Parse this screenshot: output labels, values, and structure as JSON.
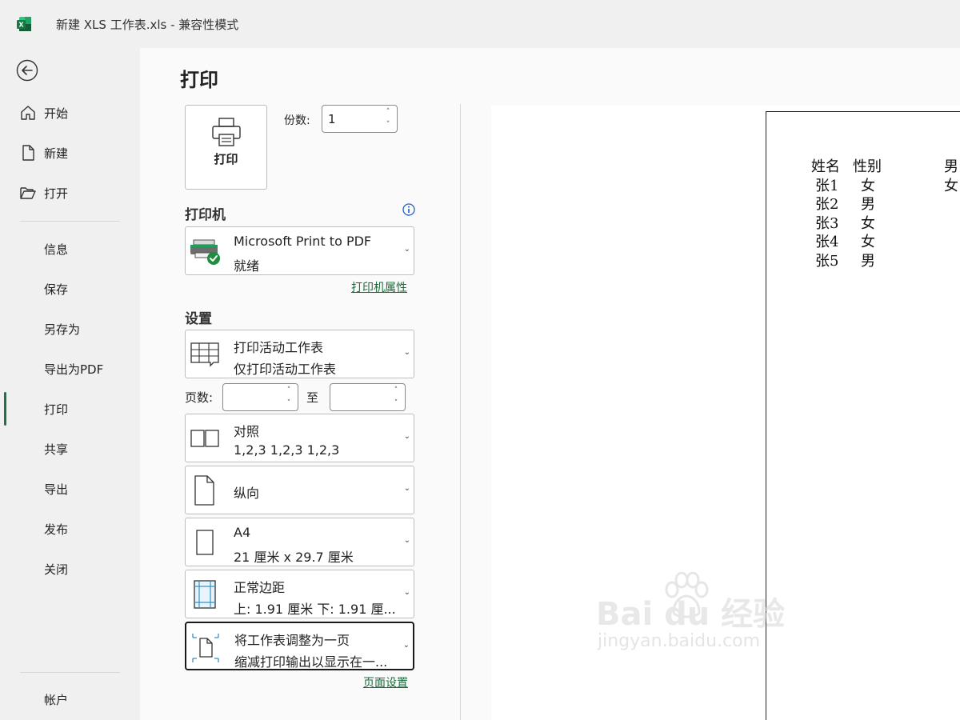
{
  "window": {
    "title": "新建 XLS 工作表.xls  -  兼容性模式"
  },
  "nav": {
    "items": [
      {
        "label": "开始",
        "icon": "home-icon"
      },
      {
        "label": "新建",
        "icon": "new-file-icon"
      },
      {
        "label": "打开",
        "icon": "open-folder-icon"
      },
      {
        "label": "信息"
      },
      {
        "label": "保存"
      },
      {
        "label": "另存为"
      },
      {
        "label": "导出为PDF"
      },
      {
        "label": "打印",
        "active": true
      },
      {
        "label": "共享"
      },
      {
        "label": "导出"
      },
      {
        "label": "发布"
      },
      {
        "label": "关闭"
      },
      {
        "label": "帐户"
      }
    ]
  },
  "print": {
    "title": "打印",
    "button_label": "打印",
    "copies_label": "份数:",
    "copies_value": "1",
    "printer_heading": "打印机",
    "printer_name": "Microsoft Print to PDF",
    "printer_status": "就绪",
    "printer_properties_link": "打印机属性",
    "settings_heading": "设置",
    "what_line1": "打印活动工作表",
    "what_line2": "仅打印活动工作表",
    "pages_label": "页数:",
    "pages_from": "",
    "to_label": "至",
    "pages_to": "",
    "collate_line1": "对照",
    "collate_line2": "1,2,3     1,2,3     1,2,3",
    "orientation": "纵向",
    "paper_line1": "A4",
    "paper_line2": "21 厘米 x 29.7 厘米",
    "margins_line1": "正常边距",
    "margins_line2": "上: 1.91 厘米 下: 1.91 厘...",
    "scaling_line1": "将工作表调整为一页",
    "scaling_line2": "缩减打印输出以显示在一...",
    "page_setup_link": "页面设置"
  },
  "preview": {
    "header": [
      "姓名",
      "性别"
    ],
    "rows": [
      [
        "张1",
        "女"
      ],
      [
        "张2",
        "男"
      ],
      [
        "张3",
        "女"
      ],
      [
        "张4",
        "女"
      ],
      [
        "张5",
        "男"
      ]
    ],
    "side_values": [
      "男",
      "女"
    ]
  },
  "watermark": {
    "brand": "Bai du 经验",
    "url": "jingyan.baidu.com"
  },
  "colors": {
    "accent": "#217346",
    "link": "#1a6b3a",
    "status_ok": "#1e8e3e"
  }
}
